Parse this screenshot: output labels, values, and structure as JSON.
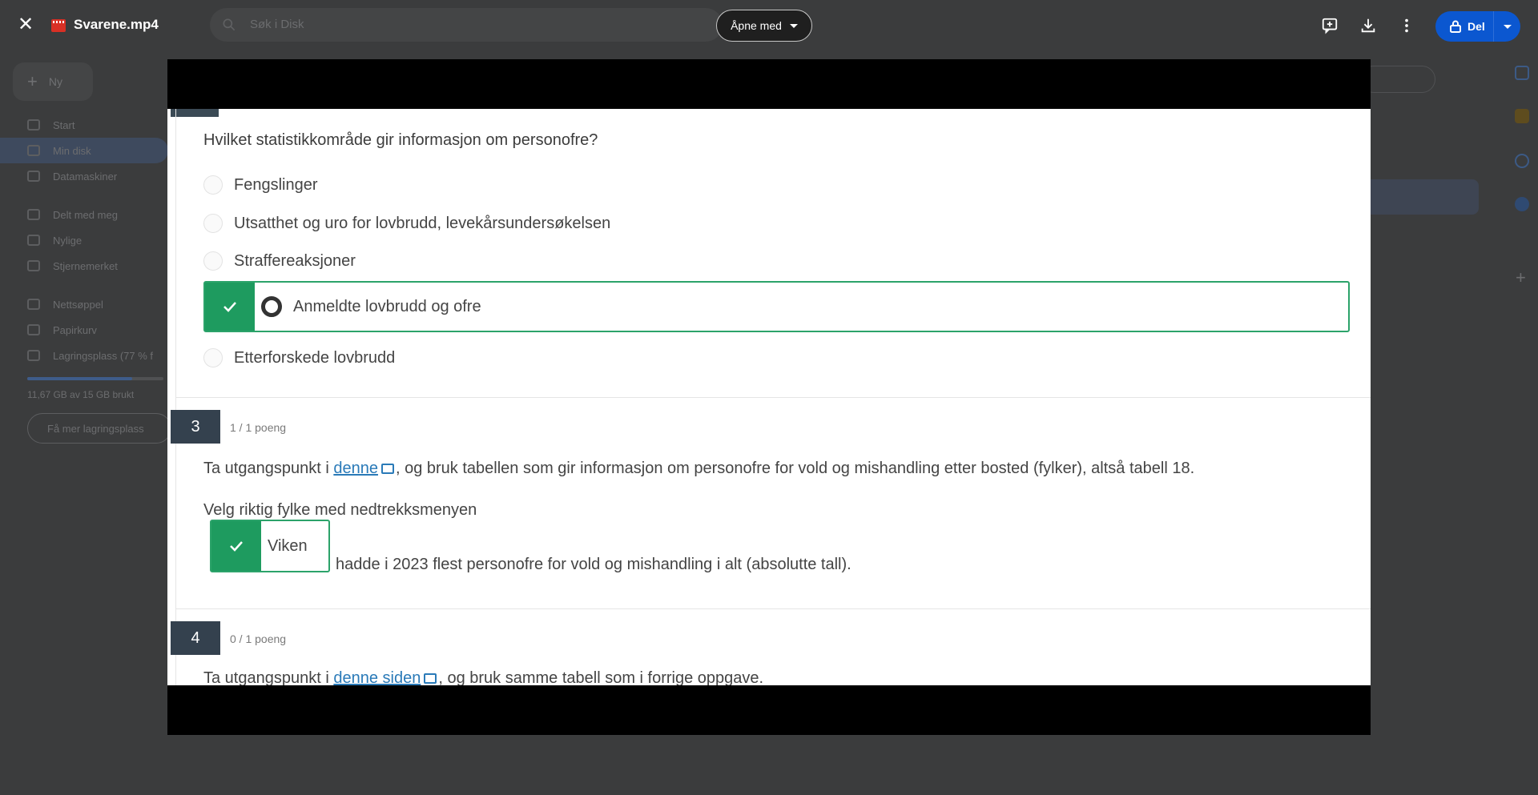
{
  "viewer": {
    "file_name": "Svarene.mp4",
    "open_with_label": "Åpne med",
    "share_label": "Del"
  },
  "background": {
    "search_placeholder": "Søk i Disk",
    "new_label": "Ny",
    "nav": [
      {
        "label": "Start"
      },
      {
        "label": "Min disk"
      },
      {
        "label": "Datamaskiner"
      },
      {
        "label": "Delt med meg"
      },
      {
        "label": "Nylige"
      },
      {
        "label": "Stjernemerket"
      },
      {
        "label": "Nettsøppel"
      },
      {
        "label": "Papirkurv"
      },
      {
        "label": "Lagringsplass (77 % f"
      }
    ],
    "quota_text": "11,67 GB av 15 GB brukt",
    "storage_fraction": 0.77,
    "more_storage_label": "Få mer lagringsplass"
  },
  "video": {
    "q2": {
      "question": "Hvilket statistikkområde gir informasjon om personofre?",
      "options": [
        "Fengslinger",
        "Utsatthet og uro for lovbrudd, levekårsundersøkelsen",
        "Straffereaksjoner",
        "Anmeldte lovbrudd og ofre",
        "Etterforskede lovbrudd"
      ],
      "correct_option": "Anmeldte lovbrudd og ofre"
    },
    "q3": {
      "number": "3",
      "points": "1 / 1 poeng",
      "text_before_link": "Ta utgangspunkt i ",
      "link_text": "denne",
      "text_after_link": ", og bruk tabellen som gir informasjon om personofre for vold og mishandling etter bosted (fylker), altså tabell 18.",
      "instruction": "Velg riktig fylke med nedtrekksmenyen",
      "answer": "Viken",
      "answer_suffix": "hadde i 2023 flest personofre for vold og mishandling i alt (absolutte tall)."
    },
    "q4": {
      "number": "4",
      "points": "0 / 1 poeng",
      "text_before_link": "Ta utgangspunkt i ",
      "link_text": "denne siden",
      "text_after_link": ", og bruk samme tabell som i forrige oppgave."
    }
  },
  "colors": {
    "share_blue": "#0b57d0",
    "correct_green": "#1e9b5f",
    "question_badge": "#34414e",
    "link_blue": "#2a7ab8"
  },
  "icons": {
    "close": "close-icon",
    "video_file": "video-file-icon",
    "comment": "add-comment-icon",
    "download": "download-icon",
    "more": "more-vert-icon",
    "lock": "lock-icon",
    "check": "check-icon"
  }
}
